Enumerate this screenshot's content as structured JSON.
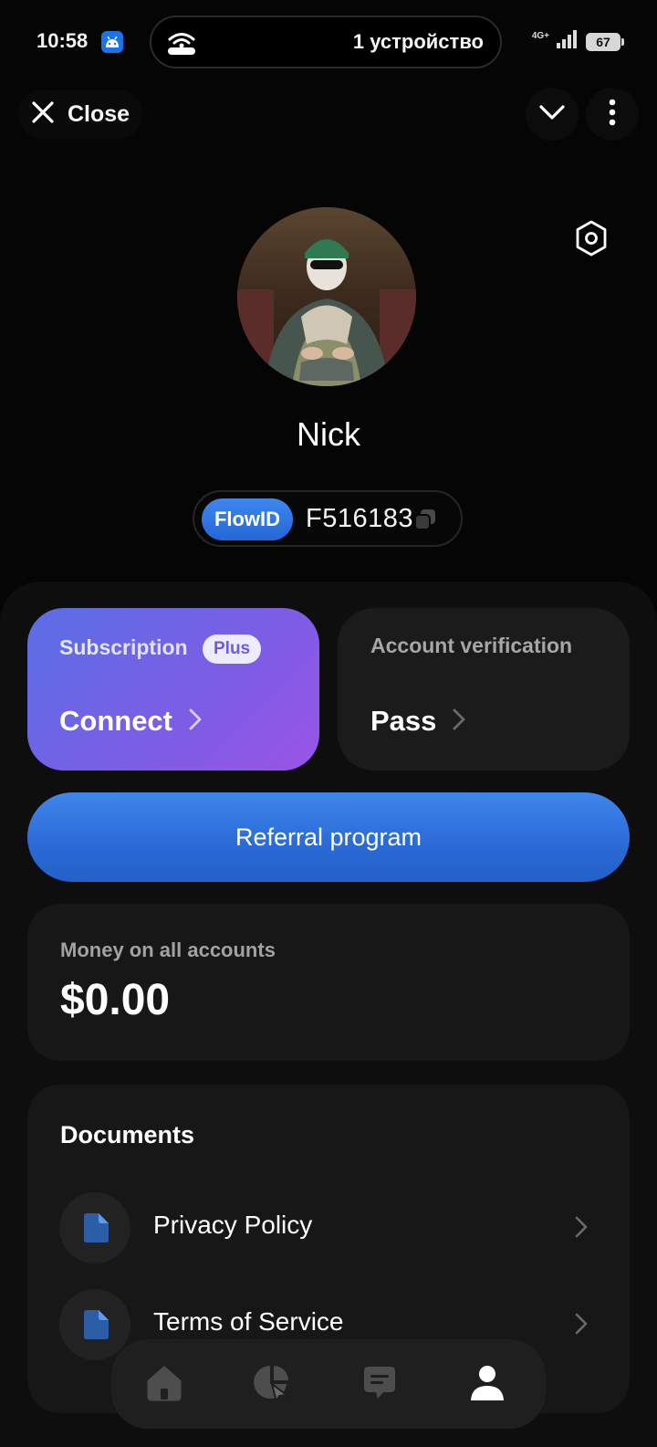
{
  "status_bar": {
    "time": "10:58",
    "island_text": "1 устройство",
    "network": "4G+",
    "battery": "67"
  },
  "top_bar": {
    "close_label": "Close"
  },
  "profile": {
    "name": "Nick",
    "flowid_badge": "FlowID",
    "flowid_value": "F516183"
  },
  "cards": {
    "subscription": {
      "label": "Subscription",
      "badge": "Plus",
      "action": "Connect"
    },
    "verification": {
      "label": "Account verification",
      "action": "Pass"
    }
  },
  "referral": {
    "label": "Referral program"
  },
  "money": {
    "label": "Money on all accounts",
    "value": "$0.00"
  },
  "documents": {
    "title": "Documents",
    "items": [
      {
        "label": "Privacy Policy",
        "icon": "document-icon"
      },
      {
        "label": "Terms of Service",
        "icon": "document-icon"
      }
    ]
  },
  "bottom_nav": {
    "items": [
      {
        "icon": "home-icon",
        "active": false
      },
      {
        "icon": "chart-icon",
        "active": false
      },
      {
        "icon": "chat-icon",
        "active": false
      },
      {
        "icon": "profile-icon",
        "active": true
      }
    ]
  },
  "colors": {
    "background": "#050505",
    "accent_blue": "#2f72e0",
    "subscription_gradient_start": "#5a6fe6",
    "subscription_gradient_end": "#9a54e6",
    "card": "#171717"
  }
}
